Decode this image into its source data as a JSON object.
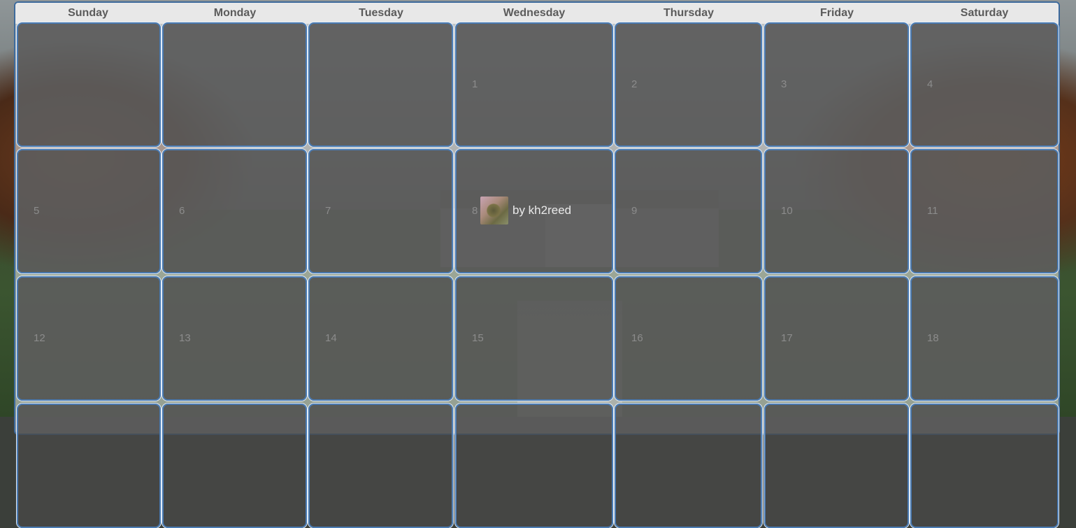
{
  "calendar": {
    "weekdays": [
      "Sunday",
      "Monday",
      "Tuesday",
      "Wednesday",
      "Thursday",
      "Friday",
      "Saturday"
    ],
    "weeks": [
      [
        "",
        "",
        "",
        "1",
        "2",
        "3",
        "4"
      ],
      [
        "5",
        "6",
        "7",
        "8",
        "9",
        "10",
        "11"
      ],
      [
        "12",
        "13",
        "14",
        "15",
        "16",
        "17",
        "18"
      ],
      [
        "",
        "",
        "",
        "",
        "",
        "",
        ""
      ]
    ],
    "event": {
      "day": "8",
      "thumbnail_icon": "user-avatar-icon",
      "byline": "by kh2reed"
    }
  }
}
